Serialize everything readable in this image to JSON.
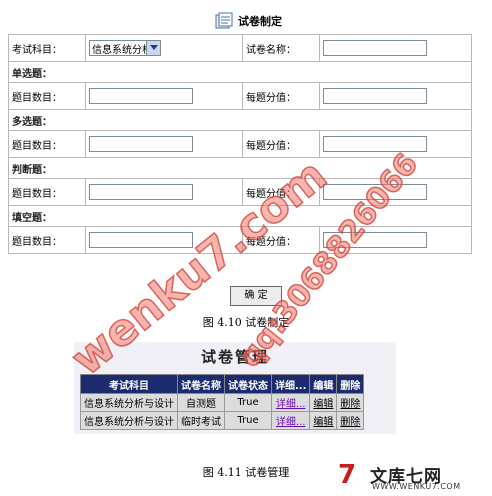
{
  "form": {
    "title": "试卷制定",
    "subject_label": "考试科目：",
    "subject_selected": "信息系统分析",
    "paper_name_label": "试卷名称：",
    "sections": [
      {
        "title": "单选题：",
        "count_label": "题目数目：",
        "score_label": "每题分值："
      },
      {
        "title": "多选题：",
        "count_label": "题目数目：",
        "score_label": "每题分值："
      },
      {
        "title": "判断题：",
        "count_label": "题目数目：",
        "score_label": "每题分值："
      },
      {
        "title": "填空题：",
        "count_label": "题目数目：",
        "score_label": "每题分值："
      }
    ],
    "confirm_label": "确 定"
  },
  "caption1": "图 4.10 试卷制定",
  "manage": {
    "title": "试卷管理",
    "headers": [
      "考试科目",
      "试卷名称",
      "试卷状态",
      "详细...",
      "编辑",
      "删除"
    ],
    "rows": [
      [
        "信息系统分析与设计",
        "自测题",
        "True",
        "详细...",
        "编辑",
        "删除"
      ],
      [
        "信息系统分析与设计",
        "临时考试",
        "True",
        "详细...",
        "编辑",
        "删除"
      ]
    ]
  },
  "caption2": "图 4.11 试卷管理",
  "watermarks": {
    "site": "wenku7.com",
    "qq": "qq:3068826066"
  },
  "logo": {
    "mark": "7",
    "text": "文库七网",
    "url": "WWW.WENKU7.COM"
  },
  "colors": {
    "header_bg": "#1c2a6e",
    "link_visited": "#6a0dad",
    "watermark": "#d23c32",
    "logo_accent": "#c81e1e"
  }
}
